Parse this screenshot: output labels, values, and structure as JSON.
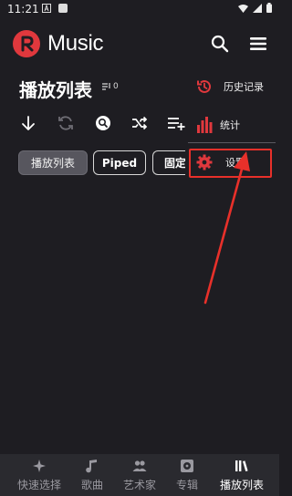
{
  "status_bar": {
    "time": "11:21"
  },
  "header": {
    "app_title": "Music"
  },
  "playlist": {
    "title": "播放列表",
    "count": "0"
  },
  "chips": [
    "播放列表",
    "Piped",
    "固定"
  ],
  "popup_menu": {
    "items": [
      {
        "label": "历史记录",
        "icon": "history-icon"
      },
      {
        "label": "统计",
        "icon": "stats-icon"
      },
      {
        "label": "设置",
        "icon": "settings-icon",
        "highlighted": true
      }
    ]
  },
  "bottom_nav": {
    "items": [
      {
        "label": "快速选择",
        "icon": "sparkle-icon"
      },
      {
        "label": "歌曲",
        "icon": "music-note-icon"
      },
      {
        "label": "艺术家",
        "icon": "artists-icon"
      },
      {
        "label": "专辑",
        "icon": "album-icon"
      },
      {
        "label": "播放列表",
        "icon": "library-icon",
        "active": true
      }
    ]
  },
  "colors": {
    "accent": "#e0383d",
    "annotation": "#e8302a",
    "background": "#1e1d22"
  }
}
